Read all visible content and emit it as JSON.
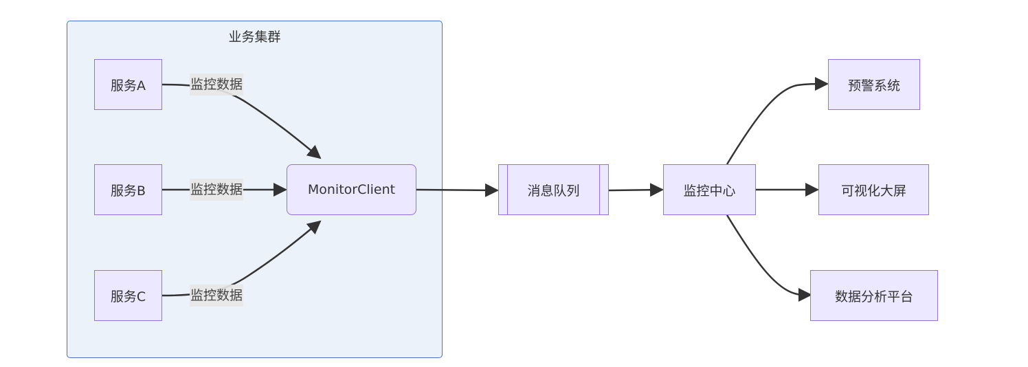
{
  "cluster": {
    "title": "业务集群"
  },
  "nodes": {
    "service_a": "服务A",
    "service_b": "服务B",
    "service_c": "服务C",
    "monitor_client": "MonitorClient",
    "message_queue": "消息队列",
    "monitor_center": "监控中心",
    "alert_system": "预警系统",
    "dashboard": "可视化大屏",
    "analytics_platform": "数据分析平台"
  },
  "edges": [
    {
      "from": "service_a",
      "to": "monitor_client",
      "label": "监控数据"
    },
    {
      "from": "service_b",
      "to": "monitor_client",
      "label": "监控数据"
    },
    {
      "from": "service_c",
      "to": "monitor_client",
      "label": "监控数据"
    },
    {
      "from": "monitor_client",
      "to": "message_queue",
      "label": ""
    },
    {
      "from": "message_queue",
      "to": "monitor_center",
      "label": ""
    },
    {
      "from": "monitor_center",
      "to": "alert_system",
      "label": ""
    },
    {
      "from": "monitor_center",
      "to": "dashboard",
      "label": ""
    },
    {
      "from": "monitor_center",
      "to": "analytics_platform",
      "label": ""
    }
  ],
  "colors": {
    "node_fill": "#ece8ff",
    "node_border": "#9370db",
    "cluster_fill": "#ecf2fa",
    "cluster_border": "#4a6fc4",
    "edge": "#333333"
  }
}
